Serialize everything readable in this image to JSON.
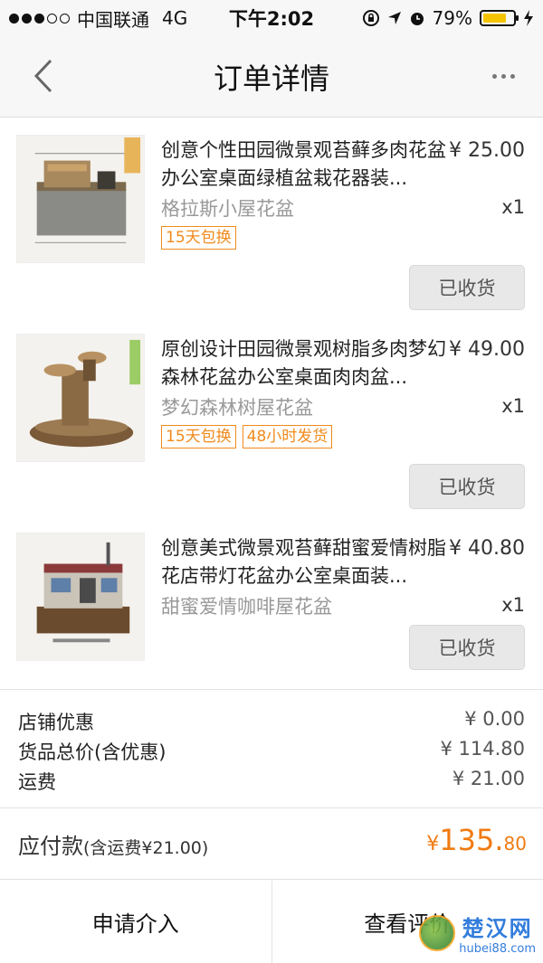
{
  "status_bar": {
    "carrier": "中国联通",
    "network": "4G",
    "time": "下午2:02",
    "battery": "79%",
    "battery_level": 0.79,
    "signal_bars": 3,
    "icons": [
      "lock-rotation-icon",
      "location-arrow-icon",
      "alarm-icon",
      "charging-icon"
    ]
  },
  "nav": {
    "title": "订单详情",
    "back_icon": "chevron-left-icon",
    "more_icon": "more-dots-icon"
  },
  "items": [
    {
      "title": "创意个性田园微景观苔藓多肉花盆办公室桌面绿植盆栽花器装...",
      "price": "¥ 25.00",
      "spec": "格拉斯小屋花盆",
      "qty": "x1",
      "tags": [
        "15天包换"
      ],
      "status": "已收货"
    },
    {
      "title": "原创设计田园微景观树脂多肉梦幻森林花盆办公室桌面肉肉盆...",
      "price": "¥ 49.00",
      "spec": "梦幻森林树屋花盆",
      "qty": "x1",
      "tags": [
        "15天包换",
        "48小时发货"
      ],
      "status": "已收货"
    },
    {
      "title": "创意美式微景观苔藓甜蜜爱情树脂花店带灯花盆办公室桌面装...",
      "price": "¥ 40.80",
      "spec": "甜蜜爱情咖啡屋花盆",
      "qty": "x1",
      "tags": [],
      "status": "已收货"
    }
  ],
  "summary": {
    "shop_discount_label": "店铺优惠",
    "shop_discount_value": "¥ 0.00",
    "goods_total_label": "货品总价(含优惠)",
    "goods_total_value": "¥ 114.80",
    "shipping_label": "运费",
    "shipping_value": "¥ 21.00"
  },
  "total": {
    "label": "应付款",
    "sub_label": "(含运费¥21.00)",
    "currency": "¥",
    "amount_int": "135.",
    "amount_dec": "80"
  },
  "footer": {
    "left_button": "申请介入",
    "right_button": "查看评价"
  },
  "watermark": {
    "name": "楚汉网",
    "url": "hubei88.com"
  },
  "colors": {
    "accent_orange": "#f07b12",
    "tag_orange": "#f08a1c",
    "battery_yellow": "#f5c400"
  }
}
